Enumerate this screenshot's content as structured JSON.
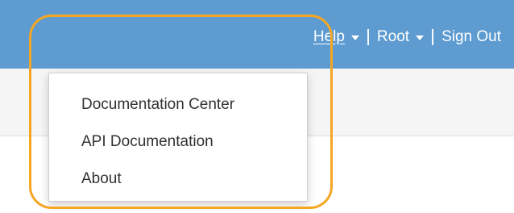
{
  "header": {
    "nav": {
      "help_label": "Help",
      "root_label": "Root",
      "sign_out_label": "Sign Out",
      "separator": "|"
    }
  },
  "help_menu": {
    "items": [
      {
        "label": "Documentation Center"
      },
      {
        "label": "API Documentation"
      },
      {
        "label": "About"
      }
    ]
  },
  "colors": {
    "header_bg": "#5d9bd0",
    "highlight": "#f5a623",
    "subbar_bg": "#f5f5f5"
  },
  "icons": {
    "help_caret": "caret-down-icon",
    "root_caret": "caret-down-icon"
  }
}
